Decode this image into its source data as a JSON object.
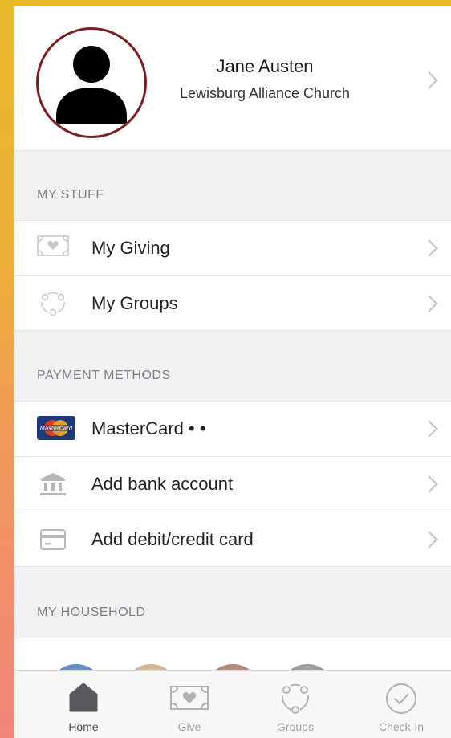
{
  "profile": {
    "name": "Jane Austen",
    "church": "Lewisburg Alliance Church"
  },
  "sections": {
    "my_stuff": {
      "header": "MY STUFF",
      "items": [
        {
          "label": "My Giving",
          "icon": "giving-icon"
        },
        {
          "label": "My Groups",
          "icon": "groups-icon"
        }
      ]
    },
    "payment_methods": {
      "header": "PAYMENT METHODS",
      "items": [
        {
          "label": "MasterCard • •",
          "icon": "mastercard-icon",
          "card_brand_text": "MasterCard"
        },
        {
          "label": "Add bank account",
          "icon": "bank-icon"
        },
        {
          "label": "Add debit/credit card",
          "icon": "credit-card-icon"
        }
      ]
    },
    "my_household": {
      "header": "MY HOUSEHOLD",
      "member_count_visible": 4
    }
  },
  "tabbar": {
    "active": "Home",
    "tabs": [
      {
        "label": "Home",
        "icon": "home-icon"
      },
      {
        "label": "Give",
        "icon": "give-icon"
      },
      {
        "label": "Groups",
        "icon": "groups-icon"
      },
      {
        "label": "Check-In",
        "icon": "check-in-icon"
      }
    ]
  },
  "colors": {
    "accent_border": "#7A1F1F",
    "background_gradient_top": "#E8B82A",
    "background_gradient_bottom": "#F1857A",
    "section_text": "#7E7E84",
    "icon_gray": "#B8B8BC"
  }
}
